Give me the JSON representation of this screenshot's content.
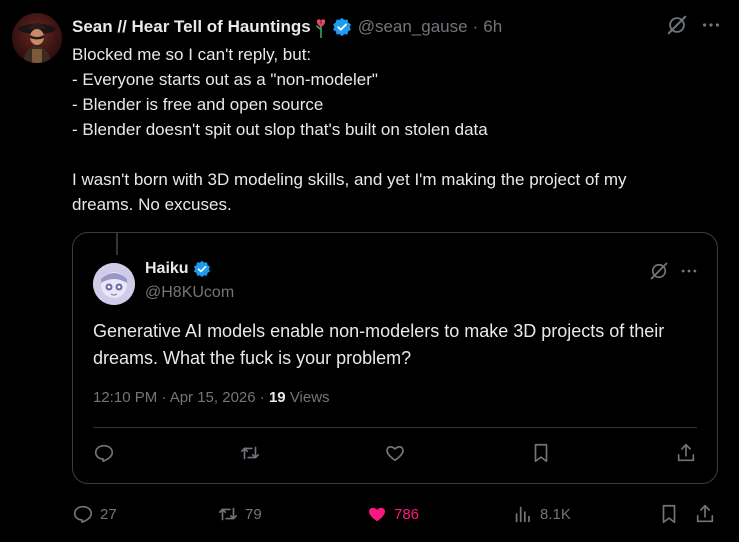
{
  "tweet": {
    "author": {
      "display_name": "Sean // Hear Tell of Hauntings",
      "handle": "@sean_gause",
      "time": "6h"
    },
    "body_lines": [
      "Blocked me so I can't reply, but:",
      "- Everyone starts out as a \"non-modeler\"",
      "- Blender is free and open source",
      "- Blender doesn't spit out slop that's built on stolen data",
      "",
      "I wasn't born with 3D modeling skills, and yet I'm making the project of my",
      "dreams. No excuses."
    ],
    "quoted": {
      "display_name": "Haiku",
      "handle": "@H8KUcom",
      "text": "Generative AI models enable non-modelers to make 3D projects of their dreams. What the fuck is your problem?",
      "time": "12:10 PM · Apr 15, 2026 ·",
      "views_count": "19",
      "views_label": "Views"
    },
    "actions": {
      "replies": "27",
      "reposts": "79",
      "likes": "786",
      "views": "8.1K"
    },
    "colors": {
      "background": "#000000",
      "text": "#e7e9ea",
      "muted": "#71767b",
      "verified": "#1d9bf0",
      "like": "#f91880",
      "border": "#3a3d40"
    },
    "icons": {
      "top": [
        "grok-icon",
        "more-icon"
      ],
      "quoted_bar": [
        "reply-icon",
        "repost-icon",
        "like-icon",
        "bookmark-icon",
        "share-icon"
      ],
      "action_bar": [
        "reply-icon",
        "repost-icon",
        "like-icon-filled",
        "views-icon",
        "bookmark-icon",
        "share-icon"
      ]
    }
  }
}
